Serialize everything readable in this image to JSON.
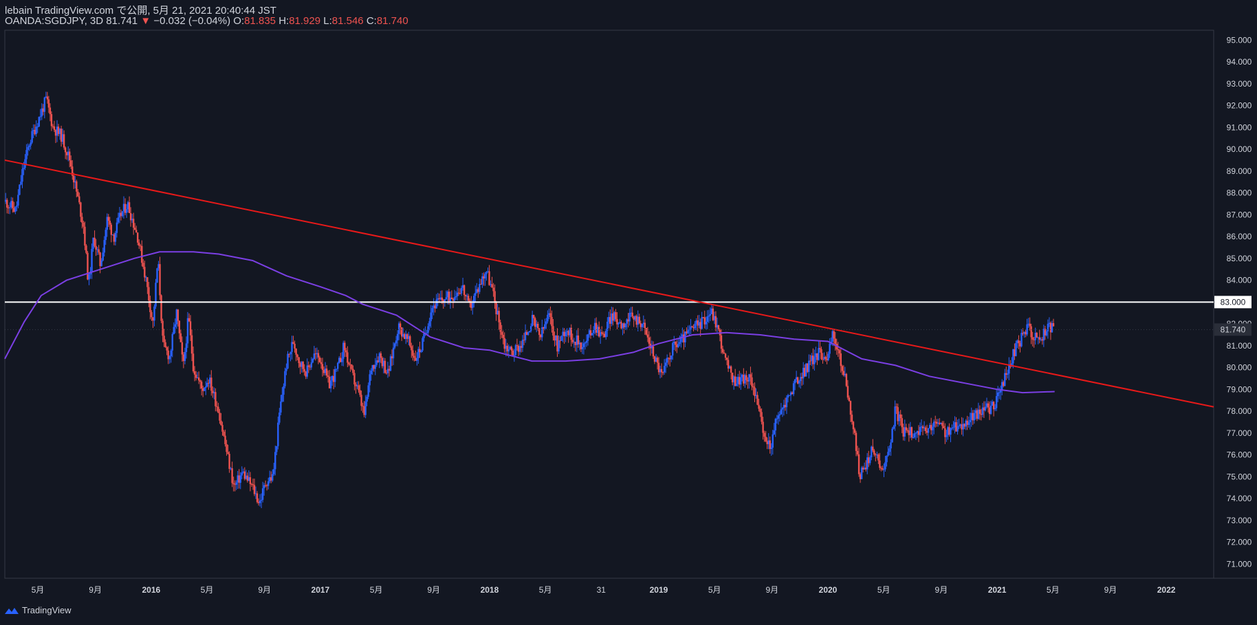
{
  "header": {
    "publisher_line": "lebain TradingView.com で公開, 5月 21, 2021 20:40:44 JST",
    "symbol": "OANDA:SGDJPY, 3D 81.741",
    "change_arrow": "▼",
    "change": "−0.032 (−0.04%)",
    "o_label": "O:",
    "o_value": "81.835",
    "h_label": "H:",
    "h_value": "81.929",
    "l_label": "L:",
    "l_value": "81.546",
    "c_label": "C:",
    "c_value": "81.740"
  },
  "brand": {
    "name": "TradingView",
    "icon": "tradingview-logo-icon"
  },
  "colors": {
    "background": "#131722",
    "up": "#2962ff",
    "down": "#ef5350",
    "trendline": "#e81919",
    "moving_average": "#7b3fe4",
    "horizontal_line": "#ffffff"
  },
  "chart_data": {
    "type": "candlestick",
    "symbol": "OANDA:SGDJPY",
    "timeframe": "3D",
    "y_axis": {
      "ticks": [
        "95.000",
        "94.000",
        "93.000",
        "92.000",
        "91.000",
        "90.000",
        "89.000",
        "88.000",
        "87.000",
        "86.000",
        "85.000",
        "84.000",
        "83.000",
        "82.000",
        "81.000",
        "80.000",
        "79.000",
        "78.000",
        "77.000",
        "76.000",
        "75.000",
        "74.000",
        "73.000",
        "72.000",
        "71.000"
      ],
      "range": [
        70.35,
        95.45
      ],
      "last_price_label": "81.740",
      "hline_label": "83.000"
    },
    "x_axis": {
      "ticks": [
        {
          "label": "5月",
          "x": 2015.33,
          "bold": false
        },
        {
          "label": "9月",
          "x": 2015.67,
          "bold": false
        },
        {
          "label": "2016",
          "x": 2016.0,
          "bold": true
        },
        {
          "label": "5月",
          "x": 2016.33,
          "bold": false
        },
        {
          "label": "9月",
          "x": 2016.67,
          "bold": false
        },
        {
          "label": "2017",
          "x": 2017.0,
          "bold": true
        },
        {
          "label": "5月",
          "x": 2017.33,
          "bold": false
        },
        {
          "label": "9月",
          "x": 2017.67,
          "bold": false
        },
        {
          "label": "2018",
          "x": 2018.0,
          "bold": true
        },
        {
          "label": "5月",
          "x": 2018.33,
          "bold": false
        },
        {
          "label": "31",
          "x": 2018.66,
          "bold": false
        },
        {
          "label": "2019",
          "x": 2019.0,
          "bold": true
        },
        {
          "label": "5月",
          "x": 2019.33,
          "bold": false
        },
        {
          "label": "9月",
          "x": 2019.67,
          "bold": false
        },
        {
          "label": "2020",
          "x": 2020.0,
          "bold": true
        },
        {
          "label": "5月",
          "x": 2020.33,
          "bold": false
        },
        {
          "label": "9月",
          "x": 2020.67,
          "bold": false
        },
        {
          "label": "2021",
          "x": 2021.0,
          "bold": true
        },
        {
          "label": "5月",
          "x": 2021.33,
          "bold": false
        },
        {
          "label": "9月",
          "x": 2021.67,
          "bold": false
        },
        {
          "label": "2022",
          "x": 2022.0,
          "bold": true
        }
      ],
      "range": [
        2015.135,
        2022.28
      ]
    },
    "close_path": [
      [
        2015.14,
        87.6
      ],
      [
        2015.2,
        87.2
      ],
      [
        2015.24,
        89.0
      ],
      [
        2015.28,
        90.3
      ],
      [
        2015.33,
        91.3
      ],
      [
        2015.38,
        92.3
      ],
      [
        2015.42,
        91.0
      ],
      [
        2015.47,
        90.6
      ],
      [
        2015.52,
        89.5
      ],
      [
        2015.56,
        88.0
      ],
      [
        2015.6,
        86.5
      ],
      [
        2015.63,
        83.8
      ],
      [
        2015.66,
        86.0
      ],
      [
        2015.7,
        84.7
      ],
      [
        2015.74,
        86.8
      ],
      [
        2015.78,
        86.0
      ],
      [
        2015.82,
        87.0
      ],
      [
        2015.86,
        87.5
      ],
      [
        2015.92,
        86.0
      ],
      [
        2015.97,
        84.0
      ],
      [
        2016.01,
        82.0
      ],
      [
        2016.04,
        85.0
      ],
      [
        2016.07,
        81.0
      ],
      [
        2016.11,
        80.5
      ],
      [
        2016.15,
        82.5
      ],
      [
        2016.19,
        80.0
      ],
      [
        2016.22,
        82.3
      ],
      [
        2016.25,
        80.0
      ],
      [
        2016.3,
        79.0
      ],
      [
        2016.34,
        79.5
      ],
      [
        2016.4,
        78.0
      ],
      [
        2016.45,
        76.0
      ],
      [
        2016.49,
        74.5
      ],
      [
        2016.54,
        75.2
      ],
      [
        2016.6,
        74.5
      ],
      [
        2016.64,
        73.8
      ],
      [
        2016.68,
        74.8
      ],
      [
        2016.72,
        75.0
      ],
      [
        2016.76,
        78.0
      ],
      [
        2016.8,
        80.2
      ],
      [
        2016.84,
        81.2
      ],
      [
        2016.88,
        80.2
      ],
      [
        2016.92,
        79.8
      ],
      [
        2016.96,
        80.6
      ],
      [
        2017.0,
        80.4
      ],
      [
        2017.05,
        79.2
      ],
      [
        2017.1,
        79.9
      ],
      [
        2017.14,
        81.0
      ],
      [
        2017.18,
        79.8
      ],
      [
        2017.22,
        79.0
      ],
      [
        2017.26,
        77.8
      ],
      [
        2017.3,
        80.0
      ],
      [
        2017.35,
        80.6
      ],
      [
        2017.4,
        79.7
      ],
      [
        2017.46,
        81.9
      ],
      [
        2017.52,
        81.2
      ],
      [
        2017.56,
        80.4
      ],
      [
        2017.6,
        81.0
      ],
      [
        2017.66,
        82.8
      ],
      [
        2017.72,
        83.1
      ],
      [
        2017.78,
        83.3
      ],
      [
        2017.84,
        83.7
      ],
      [
        2017.88,
        82.7
      ],
      [
        2017.93,
        83.6
      ],
      [
        2017.98,
        84.5
      ],
      [
        2018.02,
        83.4
      ],
      [
        2018.05,
        82.3
      ],
      [
        2018.09,
        81.0
      ],
      [
        2018.14,
        80.7
      ],
      [
        2018.2,
        81.2
      ],
      [
        2018.25,
        82.2
      ],
      [
        2018.3,
        81.4
      ],
      [
        2018.35,
        82.4
      ],
      [
        2018.4,
        81.0
      ],
      [
        2018.45,
        81.8
      ],
      [
        2018.5,
        81.3
      ],
      [
        2018.56,
        81.0
      ],
      [
        2018.62,
        82.0
      ],
      [
        2018.67,
        81.4
      ],
      [
        2018.72,
        82.4
      ],
      [
        2018.78,
        82.0
      ],
      [
        2018.84,
        82.3
      ],
      [
        2018.9,
        82.1
      ],
      [
        2018.96,
        80.8
      ],
      [
        2019.02,
        79.6
      ],
      [
        2019.08,
        80.9
      ],
      [
        2019.14,
        81.3
      ],
      [
        2019.2,
        81.8
      ],
      [
        2019.26,
        82.1
      ],
      [
        2019.31,
        82.6
      ],
      [
        2019.35,
        81.8
      ],
      [
        2019.39,
        80.4
      ],
      [
        2019.44,
        79.4
      ],
      [
        2019.5,
        79.5
      ],
      [
        2019.55,
        79.4
      ],
      [
        2019.58,
        78.6
      ],
      [
        2019.62,
        76.8
      ],
      [
        2019.66,
        76.4
      ],
      [
        2019.7,
        77.7
      ],
      [
        2019.75,
        78.4
      ],
      [
        2019.8,
        79.2
      ],
      [
        2019.85,
        79.7
      ],
      [
        2019.9,
        80.3
      ],
      [
        2019.95,
        80.7
      ],
      [
        2020.0,
        80.5
      ],
      [
        2020.03,
        81.6
      ],
      [
        2020.07,
        80.4
      ],
      [
        2020.11,
        79.2
      ],
      [
        2020.15,
        77.2
      ],
      [
        2020.19,
        75.0
      ],
      [
        2020.23,
        75.7
      ],
      [
        2020.27,
        76.3
      ],
      [
        2020.31,
        75.4
      ],
      [
        2020.35,
        75.8
      ],
      [
        2020.4,
        78.1
      ],
      [
        2020.45,
        77.0
      ],
      [
        2020.52,
        77.1
      ],
      [
        2020.58,
        77.0
      ],
      [
        2020.64,
        77.5
      ],
      [
        2020.7,
        77.0
      ],
      [
        2020.76,
        77.3
      ],
      [
        2020.82,
        77.5
      ],
      [
        2020.9,
        78.0
      ],
      [
        2020.98,
        78.2
      ],
      [
        2021.02,
        79.0
      ],
      [
        2021.06,
        79.8
      ],
      [
        2021.1,
        80.7
      ],
      [
        2021.14,
        81.3
      ],
      [
        2021.18,
        81.9
      ],
      [
        2021.22,
        81.4
      ],
      [
        2021.26,
        81.3
      ],
      [
        2021.3,
        81.9
      ],
      [
        2021.34,
        81.74
      ]
    ],
    "moving_average": [
      [
        2015.135,
        80.4
      ],
      [
        2015.25,
        82.1
      ],
      [
        2015.35,
        83.3
      ],
      [
        2015.5,
        84.0
      ],
      [
        2015.7,
        84.5
      ],
      [
        2015.9,
        85.0
      ],
      [
        2016.05,
        85.3
      ],
      [
        2016.25,
        85.3
      ],
      [
        2016.4,
        85.2
      ],
      [
        2016.6,
        84.9
      ],
      [
        2016.8,
        84.2
      ],
      [
        2017.0,
        83.7
      ],
      [
        2017.15,
        83.3
      ],
      [
        2017.25,
        82.9
      ],
      [
        2017.45,
        82.4
      ],
      [
        2017.65,
        81.4
      ],
      [
        2017.85,
        80.9
      ],
      [
        2018.0,
        80.8
      ],
      [
        2018.25,
        80.3
      ],
      [
        2018.45,
        80.3
      ],
      [
        2018.65,
        80.4
      ],
      [
        2018.85,
        80.7
      ],
      [
        2019.0,
        81.1
      ],
      [
        2019.2,
        81.5
      ],
      [
        2019.4,
        81.6
      ],
      [
        2019.6,
        81.5
      ],
      [
        2019.8,
        81.3
      ],
      [
        2020.0,
        81.2
      ],
      [
        2020.2,
        80.4
      ],
      [
        2020.4,
        80.1
      ],
      [
        2020.6,
        79.6
      ],
      [
        2020.8,
        79.3
      ],
      [
        2021.0,
        79.0
      ],
      [
        2021.15,
        78.85
      ],
      [
        2021.34,
        78.9
      ]
    ],
    "trendline": {
      "x1": 2015.135,
      "y1": 89.5,
      "x2": 2022.28,
      "y2": 78.2
    },
    "horizontal_line": {
      "y": 83.0
    },
    "last_price": 81.74
  }
}
